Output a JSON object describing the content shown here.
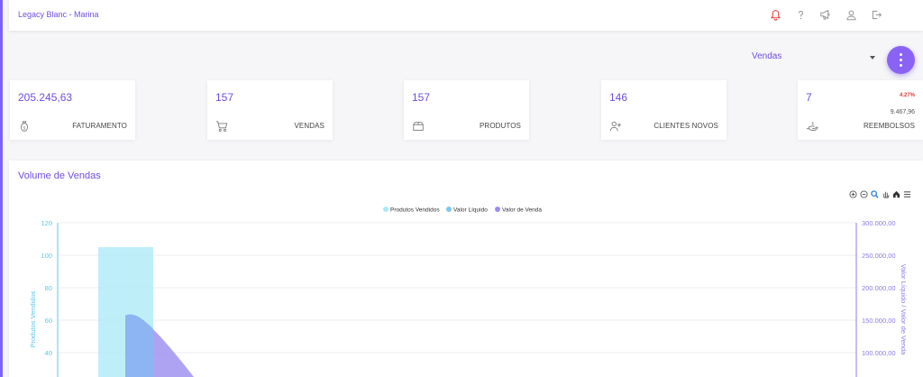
{
  "app": {
    "title": "Legacy Blanc - Marina",
    "top_icons": [
      {
        "name": "bell-icon",
        "color": "#e53935"
      },
      {
        "name": "help-icon",
        "color": "#9a9a9a"
      },
      {
        "name": "megaphone-icon",
        "color": "#9a9a9a"
      },
      {
        "name": "user-icon",
        "color": "#9a9a9a"
      },
      {
        "name": "logout-icon",
        "color": "#9a9a9a"
      }
    ]
  },
  "filter": {
    "selected": "Vendas"
  },
  "fab": {
    "icon": "more-vertical-icon",
    "color": "#8a63f5"
  },
  "cards": [
    {
      "value": "205.245,63",
      "label": "FATURAMENTO",
      "icon": "money-bag-icon"
    },
    {
      "value": "157",
      "label": "VENDAS",
      "icon": "cart-icon"
    },
    {
      "value": "157",
      "label": "PRODUTOS",
      "icon": "box-icon"
    },
    {
      "value": "146",
      "label": "CLIENTES NOVOS",
      "icon": "user-plus-icon"
    },
    {
      "value": "7",
      "label": "REEMBOLSOS",
      "icon": "refund-icon",
      "percent": "4.27%",
      "sub_value": "9.467,96"
    }
  ],
  "chart_panel": {
    "title": "Volume de Vendas",
    "toolbar": [
      "zoom-in-icon",
      "zoom-out-icon",
      "magnify-icon",
      "pan-icon",
      "home-icon",
      "menu-icon"
    ]
  },
  "chart_data": {
    "type": "bar",
    "title": "",
    "legend": {
      "position": "top-center",
      "entries": [
        "Produtos Vendidos",
        "Valor Líquido",
        "Valor de Venda"
      ]
    },
    "series": [
      {
        "name": "Produtos Vendidos",
        "type": "bar",
        "axis": "left",
        "color": "#a8eaf7",
        "values": [
          105
        ]
      },
      {
        "name": "Valor Líquido",
        "type": "area",
        "axis": "right",
        "color": "#7ec6f2"
      },
      {
        "name": "Valor de Venda",
        "type": "area",
        "axis": "right",
        "color": "#9a8cf0",
        "peak": 160000
      }
    ],
    "y_left": {
      "label": "Produtos Vendidos",
      "ticks": [
        "120",
        "100",
        "80",
        "60",
        "40"
      ],
      "min": 20,
      "max": 120,
      "color": "#5ac8e6"
    },
    "y_right": {
      "label": "Valor Líquido / Valor de Venda",
      "ticks": [
        "300.000,00",
        "250.000,00",
        "200.000,00",
        "150.000,00",
        "100.000,00"
      ],
      "min": 50000,
      "max": 300000,
      "color": "#8a7ce8"
    },
    "grid": true
  }
}
